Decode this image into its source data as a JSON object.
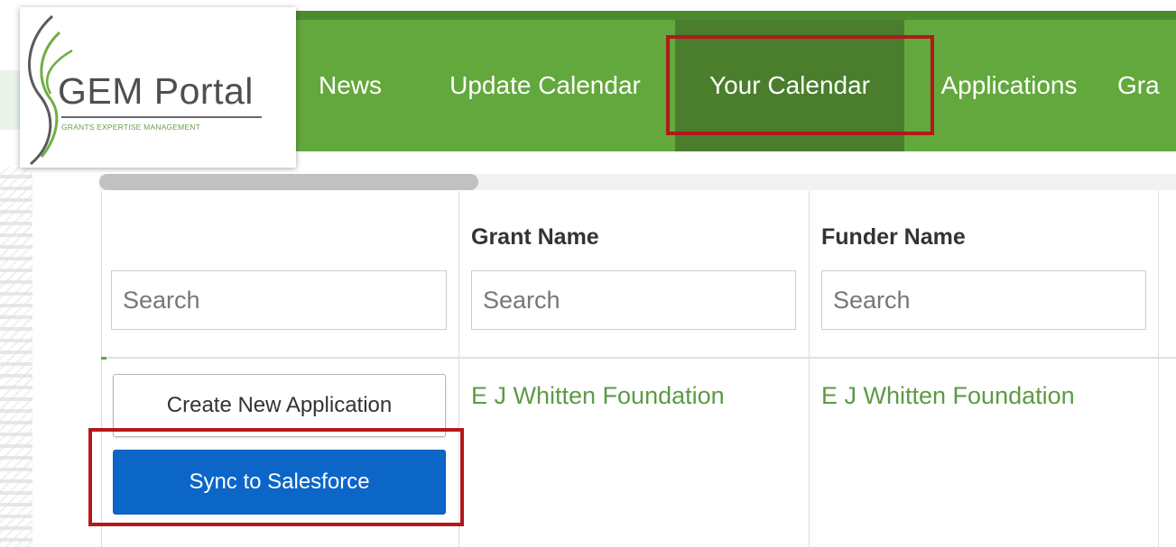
{
  "logo": {
    "title": "GEM Portal",
    "subtitle": "GRANTS EXPERTISE MANAGEMENT"
  },
  "nav": {
    "items": [
      {
        "label": "News"
      },
      {
        "label": "Update Calendar"
      },
      {
        "label": "Your Calendar",
        "active": true
      },
      {
        "label": "Applications"
      },
      {
        "label": "Gra"
      }
    ]
  },
  "table": {
    "columns": [
      {
        "header": "",
        "search_placeholder": "Search"
      },
      {
        "header": "Grant Name",
        "search_placeholder": "Search"
      },
      {
        "header": "Funder Name",
        "search_placeholder": "Search"
      }
    ],
    "rows": [
      {
        "actions": {
          "create_label": "Create New Application",
          "sync_label": "Sync to Salesforce"
        },
        "grant_name": "E J Whitten Foundation",
        "funder_name": "E J Whitten Foundation"
      }
    ]
  },
  "colors": {
    "nav_green": "#63a83c",
    "nav_active": "#4a7e2c",
    "link_green": "#5c9a45",
    "sync_blue": "#0b66c8",
    "highlight_red": "#b3191a"
  }
}
